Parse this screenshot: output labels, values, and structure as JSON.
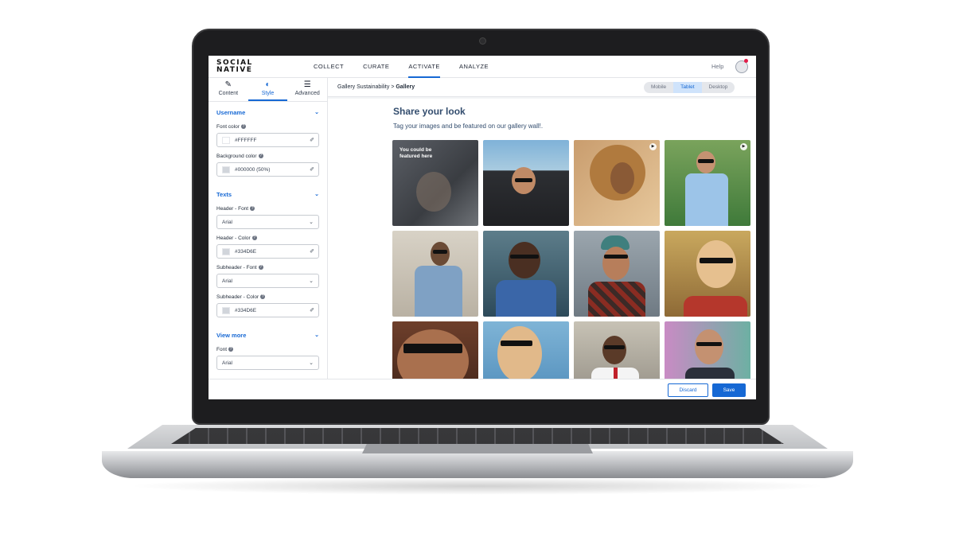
{
  "topbar": {
    "logo_line1": "SOCIAL",
    "logo_line2": "NATIVE",
    "nav": [
      "COLLECT",
      "CURATE",
      "ACTIVATE",
      "ANALYZE"
    ],
    "active_nav": "ACTIVATE",
    "help": "Help",
    "avatar_icon": "user-avatar-icon"
  },
  "sidebar": {
    "tabs": [
      {
        "label": "Content",
        "icon": "pencil-icon"
      },
      {
        "label": "Style",
        "icon": "drop-icon"
      },
      {
        "label": "Advanced",
        "icon": "sliders-icon"
      }
    ],
    "active_tab": "Style",
    "username": {
      "title": "Username",
      "font_color_label": "Font color",
      "font_color_value": "#FFFFFF",
      "bg_color_label": "Background color",
      "bg_color_value": "#000000 (50%)"
    },
    "texts": {
      "title": "Texts",
      "header_font_label": "Header - Font",
      "header_font_value": "Arial",
      "header_color_label": "Header - Color",
      "header_color_value": "#334D6E",
      "subheader_font_label": "Subheader - Font",
      "subheader_font_value": "Arial",
      "subheader_color_label": "Subheader - Color",
      "subheader_color_value": "#334D6E"
    },
    "view_more": {
      "title": "View more",
      "font_label": "Font",
      "font_value": "Arial"
    }
  },
  "main": {
    "breadcrumb_parent": "Gallery Sustainability",
    "breadcrumb_sep": " > ",
    "breadcrumb_current": "Gallery",
    "devices": [
      "Mobile",
      "Tablet",
      "Desktop"
    ],
    "active_device": "Tablet",
    "gallery": {
      "title": "Share your look",
      "subtitle": "Tag your images and be featured on our gallery wall!.",
      "placeholder_text": "You could be featured here"
    }
  },
  "footer": {
    "discard": "Discard",
    "save": "Save"
  },
  "colors": {
    "accent": "#1668d4",
    "heading": "#334D6E"
  }
}
